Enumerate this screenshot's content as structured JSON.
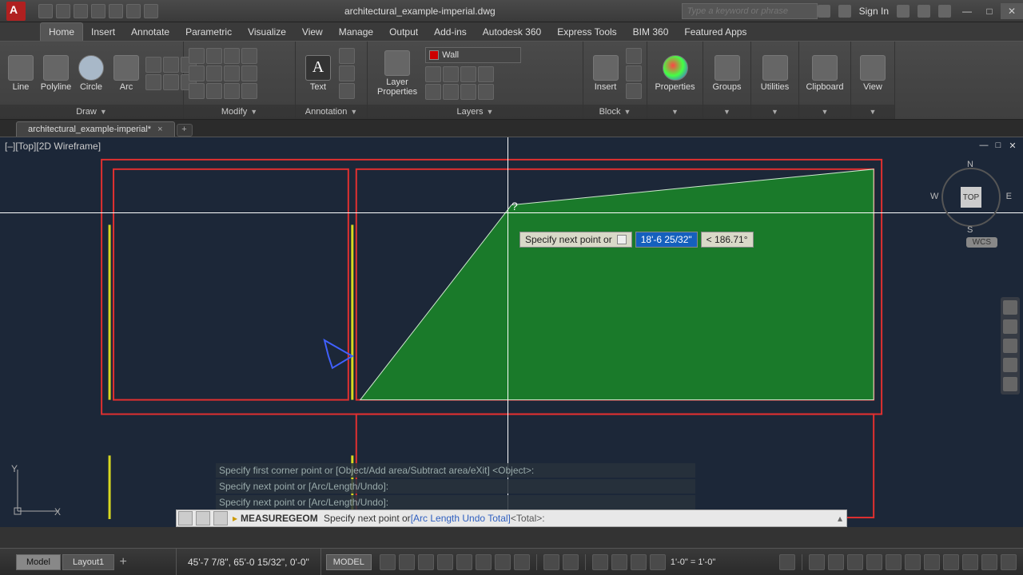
{
  "title": "architectural_example-imperial.dwg",
  "search_placeholder": "Type a keyword or phrase",
  "signin": "Sign In",
  "tabs": [
    "Home",
    "Insert",
    "Annotate",
    "Parametric",
    "Visualize",
    "View",
    "Manage",
    "Output",
    "Add-ins",
    "Autodesk 360",
    "Express Tools",
    "BIM 360",
    "Featured Apps"
  ],
  "active_tab": "Home",
  "panels": {
    "draw": {
      "title": "Draw",
      "items": [
        "Line",
        "Polyline",
        "Circle",
        "Arc"
      ]
    },
    "modify": {
      "title": "Modify"
    },
    "annotation": {
      "title": "Annotation",
      "text": "Text"
    },
    "layers": {
      "title": "Layers",
      "btn": "Layer\nProperties",
      "current": "Wall"
    },
    "block": {
      "title": "Block",
      "btn": "Insert"
    },
    "properties": {
      "title": "Properties"
    },
    "groups": {
      "title": "Groups"
    },
    "utilities": {
      "title": "Utilities"
    },
    "clipboard": {
      "title": "Clipboard"
    },
    "view": {
      "title": "View"
    }
  },
  "filetab": "architectural_example-imperial*",
  "viewport_label": "[–][Top][2D Wireframe]",
  "dyn": {
    "prompt": "Specify next point or",
    "dist": "18'-6 25/32\"",
    "angle": "< 186.71°"
  },
  "viewcube": {
    "face": "TOP",
    "n": "N",
    "s": "S",
    "e": "E",
    "w": "W",
    "wcs": "WCS"
  },
  "cmd_history": [
    "Specify first corner point or [Object/Add area/Subtract area/eXit] <Object>:",
    "Specify next point or [Arc/Length/Undo]:",
    "Specify next point or [Arc/Length/Undo]:"
  ],
  "cmdline": {
    "cmd": "MEASUREGEOM",
    "prompt": "Specify next point or ",
    "opts": "[Arc Length Undo Total]",
    "default": " <Total>:"
  },
  "bottom_tabs": [
    "Model",
    "Layout1"
  ],
  "coords": "45'-7 7/8\", 65'-0 15/32\", 0'-0\"",
  "model_btn": "MODEL",
  "scale": "1'-0\" = 1'-0\""
}
